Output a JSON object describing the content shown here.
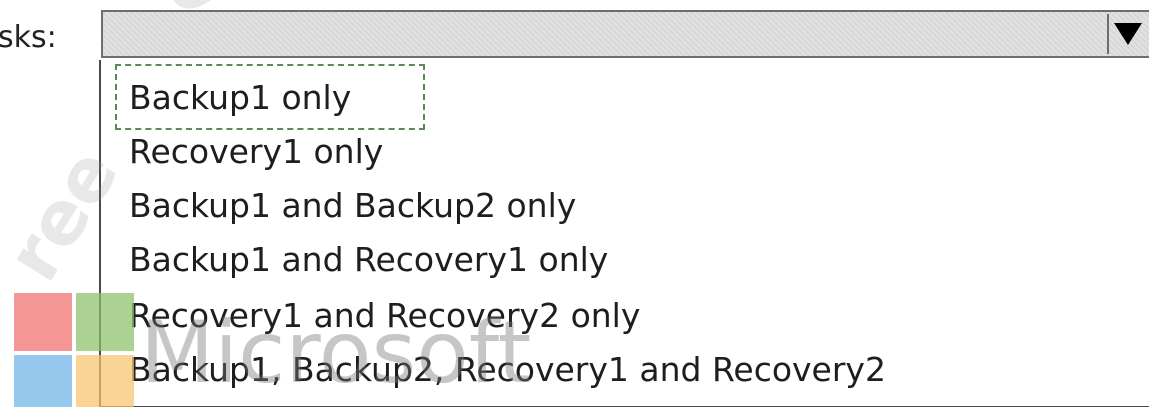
{
  "field": {
    "label": "sks:"
  },
  "combo": {
    "selected_value": "",
    "arrow_icon": "triangle-down-icon"
  },
  "dropdown": {
    "options": [
      "Backup1 only",
      "Recovery1 only",
      "Backup1 and Backup2 only",
      "Backup1 and Recovery1 only",
      "Recovery1 and Recovery2 only",
      "Backup1, Backup2, Recovery1 and Recovery2"
    ],
    "focused_index": 0
  },
  "watermark": {
    "text_top": "eedi",
    "text_left": "ree",
    "logo_text": "Microsoft",
    "logo_colors": [
      "#f25022",
      "#7fba00",
      "#00a4ef",
      "#ffb900"
    ]
  }
}
